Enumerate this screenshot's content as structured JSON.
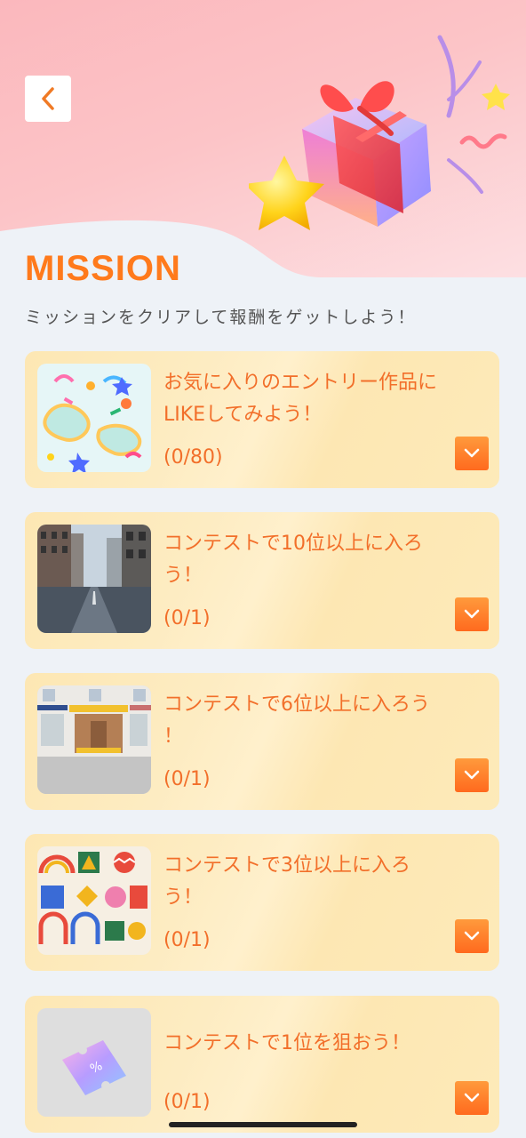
{
  "header": {
    "back_icon": "chevron-left-icon",
    "illustration": "gift-box-with-star"
  },
  "title": "MISSION",
  "subtitle": "ミッションをクリアして報酬をゲットしよう！",
  "missions": [
    {
      "text_line1": "お気に入りのエントリー作品に",
      "text_line2": "LIKEしてみよう！",
      "progress": "(0/80)",
      "thumbnail": "colorful-confetti-shapes"
    },
    {
      "text_line1": "コンテストで10位以上に入ろ",
      "text_line2": "う！",
      "progress": "(0/1)",
      "thumbnail": "city-street"
    },
    {
      "text_line1": "コンテストで6位以上に入ろう",
      "text_line2": "！",
      "progress": "(0/1)",
      "thumbnail": "shop-front"
    },
    {
      "text_line1": "コンテストで3位以上に入ろ",
      "text_line2": "う！",
      "progress": "(0/1)",
      "thumbnail": "geometric-pattern"
    },
    {
      "text_line1": "コンテストで1位を狙おう！",
      "text_line2": "",
      "progress": "(0/1)",
      "thumbnail": "holographic-ticket"
    }
  ],
  "colors": {
    "accent": "#ff7a1c",
    "card_text": "#f26f2a",
    "card_bg": "#fde7b3",
    "page_bg": "#eef2f7"
  }
}
